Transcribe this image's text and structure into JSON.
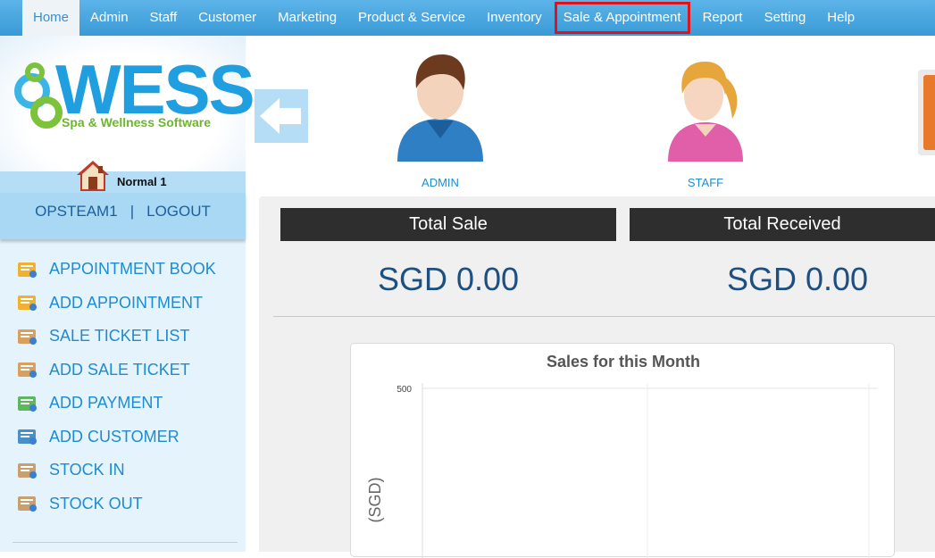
{
  "nav": {
    "items": [
      "Home",
      "Admin",
      "Staff",
      "Customer",
      "Marketing",
      "Product & Service",
      "Inventory",
      "Sale & Appointment",
      "Report",
      "Setting",
      "Help"
    ],
    "active": "Home",
    "highlighted": "Sale & Appointment"
  },
  "sidebar": {
    "logo_text": "WESS",
    "logo_subtitle": "Spa & Wellness Software",
    "status": "Normal 1",
    "user": "OPSTEAM1",
    "separator": "|",
    "logout": "LOGOUT",
    "menu": [
      {
        "label": "APPOINTMENT BOOK",
        "icon": "appointment-book-icon"
      },
      {
        "label": "ADD APPOINTMENT",
        "icon": "add-appointment-icon"
      },
      {
        "label": "SALE TICKET LIST",
        "icon": "sale-ticket-list-icon"
      },
      {
        "label": "ADD SALE TICKET",
        "icon": "add-sale-ticket-icon"
      },
      {
        "label": "ADD PAYMENT",
        "icon": "payment-icon"
      },
      {
        "label": "ADD CUSTOMER",
        "icon": "add-customer-icon"
      },
      {
        "label": "STOCK IN",
        "icon": "stock-in-icon"
      },
      {
        "label": "STOCK OUT",
        "icon": "stock-out-icon"
      }
    ]
  },
  "quick": {
    "admin_label": "ADMIN",
    "staff_label": "STAFF"
  },
  "kpis": {
    "total_sale_label": "Total Sale",
    "total_sale_value": "SGD 0.00",
    "total_received_label": "Total Received",
    "total_received_value": "SGD 0.00"
  },
  "chart_data": {
    "type": "line",
    "title": "Sales for this Month",
    "ylabel": "(SGD)",
    "xlabel": "",
    "yticks": [
      "500"
    ],
    "ylim": [
      0,
      500
    ],
    "series": [],
    "grid": true
  },
  "colors": {
    "nav_bg": "#3a9ad6",
    "link": "#1e8ccf",
    "highlight_border": "#e0121c",
    "kpi_header": "#2e2e2e",
    "kpi_value": "#1d4f80"
  }
}
